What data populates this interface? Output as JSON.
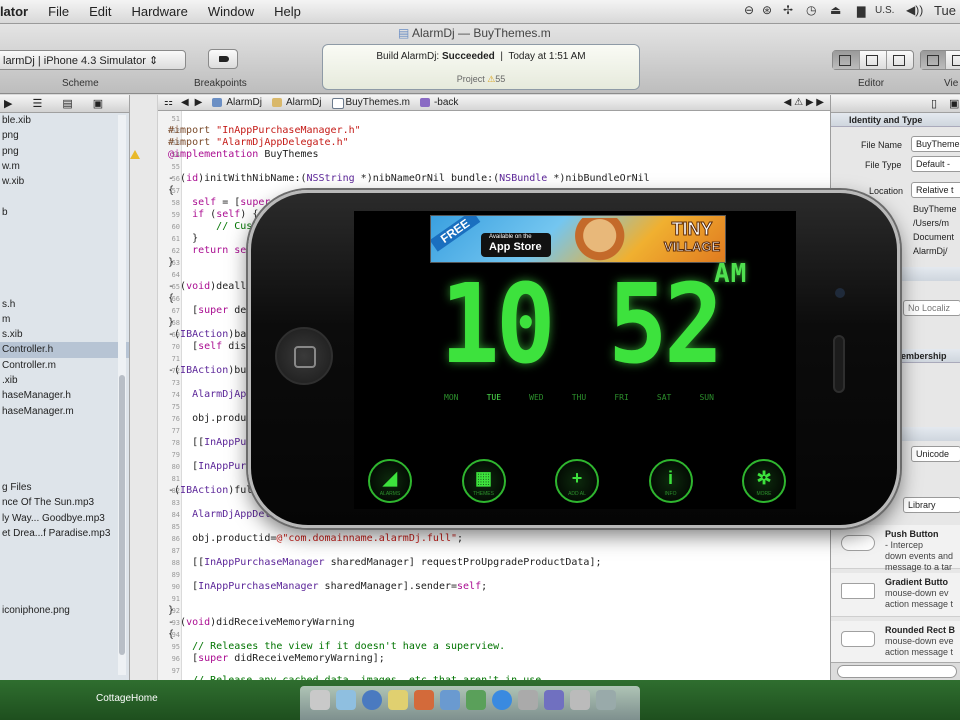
{
  "menubar": {
    "app_name": "ulator",
    "items": [
      "File",
      "Edit",
      "Hardware",
      "Window",
      "Help"
    ],
    "input_language": "U.S.",
    "clock": "Tue"
  },
  "toolbar": {
    "window_title": "AlarmDj — BuyThemes.m",
    "scheme_value": "larmDj | iPhone 4.3 Simulator",
    "scheme_label": "Scheme",
    "breakpoints_label": "Breakpoints",
    "build_project": "Build AlarmDj:",
    "build_status": "Succeeded",
    "build_time": "Today at 1:51 AM",
    "project_label": "Project",
    "issue_count": "55",
    "editor_label": "Editor",
    "view_label": "Vie"
  },
  "navigator": {
    "files": [
      "ble.xib",
      "png",
      "png",
      "w.m",
      "w.xib",
      "",
      "b",
      "",
      "",
      "",
      "",
      "",
      "s.h",
      "m",
      "s.xib",
      "Controller.h",
      "Controller.m",
      ".xib",
      "haseManager.h",
      "haseManager.m",
      "",
      "",
      "",
      "",
      "g Files",
      "nce Of The Sun.mp3",
      "ly Way... Goodbye.mp3",
      "et Drea...f Paradise.mp3",
      "",
      "",
      "",
      "",
      "iconiphone.png"
    ]
  },
  "jumpbar": {
    "crumbs": [
      "AlarmDj",
      "AlarmDj",
      "BuyThemes.m",
      "-back"
    ]
  },
  "editor": {
    "line_numbers": [
      "51",
      "52",
      "53",
      "54",
      "55",
      "56",
      "57",
      "58",
      "59",
      "60",
      "61",
      "62",
      "63",
      "64",
      "65",
      "66",
      "67",
      "68",
      "69",
      "70",
      "71",
      "72",
      "73",
      "74",
      "75",
      "76",
      "77",
      "78",
      "79",
      "80",
      "81",
      "82",
      "83",
      "84",
      "85",
      "86",
      "87",
      "88",
      "89",
      "90",
      "91",
      "92",
      "93",
      "94",
      "95",
      "96",
      "97"
    ]
  },
  "utilities": {
    "identity_header": "Identity and Type",
    "file_name_label": "File Name",
    "file_name_value": "BuyTheme",
    "file_type_label": "File Type",
    "file_type_value": "Default -",
    "location_label": "Location",
    "location_value": "Relative t",
    "path_lines": [
      "BuyTheme",
      "/Users/m",
      "Document",
      "AlarmDj/"
    ],
    "localization_value": "No Localiz",
    "membership_header": "embership",
    "encoding_value": "Unicode",
    "library_value": "Library",
    "library_items": [
      {
        "title": "Push Button",
        "desc": "- Intercep\ndown events and\nmessage to a tar"
      },
      {
        "title": "Gradient Butto",
        "desc": "mouse-down ev\naction message t"
      },
      {
        "title": "Rounded Rect B",
        "desc": "mouse-down eve\naction message t"
      }
    ]
  },
  "desktop": {
    "label": "CottageHome"
  },
  "app": {
    "ad_free": "FREE",
    "ad_store_small": "Available on the",
    "ad_store": "App Store",
    "ad_title_1": "TINY",
    "ad_title_2": "VILLAGE",
    "time": "10 52",
    "ampm": "AM",
    "days": [
      "MON",
      "TUE",
      "WED",
      "THU",
      "FRI",
      "SAT",
      "SUN"
    ],
    "buttons": [
      {
        "glyph": "◢",
        "caption": "ALARMS"
      },
      {
        "glyph": "▦",
        "caption": "THEMES"
      },
      {
        "glyph": "+",
        "caption": "ADD AL"
      },
      {
        "glyph": "i",
        "caption": "INFO"
      },
      {
        "glyph": "✲",
        "caption": "MORE"
      }
    ]
  },
  "colors": {
    "lcd_green": "#3de23d",
    "lcd_dim": "#2c8f2c",
    "keyword": "#aa0d91",
    "string": "#c41a16",
    "comment": "#007400",
    "class": "#5c2699"
  }
}
